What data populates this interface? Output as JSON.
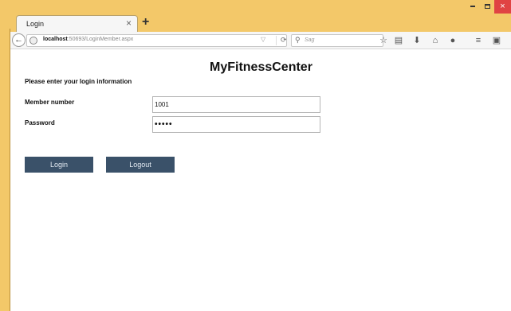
{
  "browser": {
    "tab_title": "Login",
    "tab_close": "×",
    "new_tab": "+",
    "url_host": "localhost",
    "url_path": ":50693/LoginMember.aspx",
    "search_placeholder": "Sag",
    "window_controls": {
      "minimize": "minimize-icon",
      "maximize": "maximize-icon",
      "close": "×"
    },
    "toolbar_icons": [
      "star-icon",
      "reading-list-icon",
      "download-icon",
      "home-icon",
      "chat-icon",
      "menu-icon",
      "pocket-icon"
    ]
  },
  "page": {
    "title": "MyFitnessCenter",
    "instructions": "Please enter your login information",
    "member_number_label": "Member number",
    "member_number_value": "1001",
    "password_label": "Password",
    "password_value": "•••••",
    "login_label": "Login",
    "logout_label": "Logout"
  },
  "colors": {
    "window_frame": "#f3c869",
    "button_bg": "#3a5169",
    "window_close": "#e04343"
  }
}
